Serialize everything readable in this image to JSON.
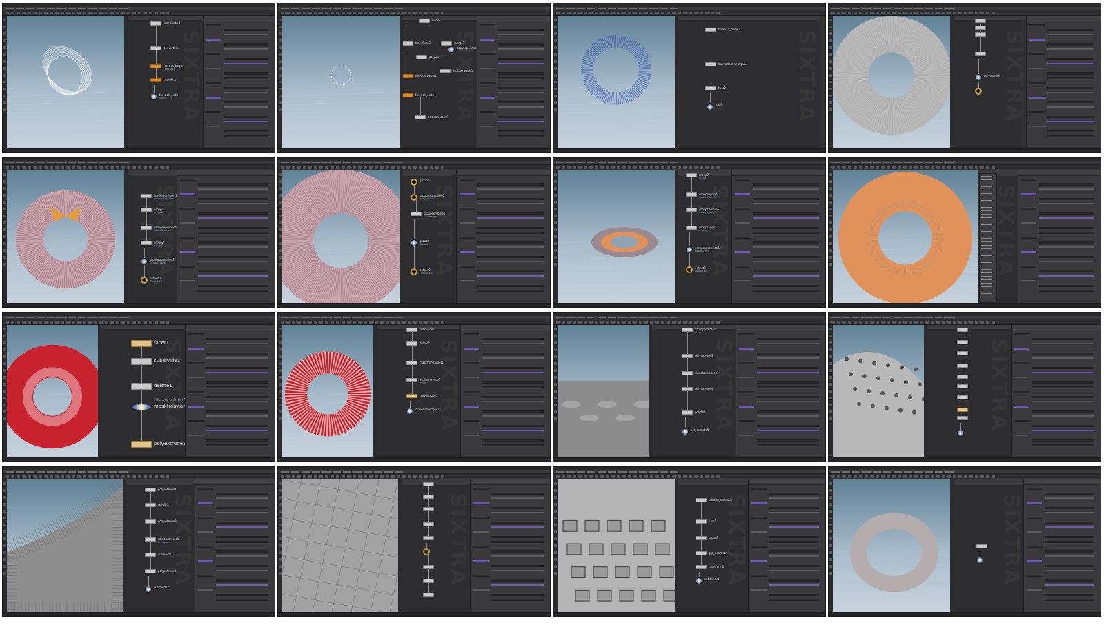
{
  "grid": {
    "columns": 4,
    "rows": 4
  },
  "shots": [
    {
      "id": "s1",
      "nodes": [
        {
          "label": "facetEmbed",
          "sub": ""
        },
        {
          "label": "convertLine",
          "sub": ""
        },
        {
          "label": "foreach_begin1",
          "sub": "FeedBack_1",
          "style": "orange"
        },
        {
          "label": "trans&ctrl",
          "sub": "",
          "style": "orange"
        },
        {
          "label": "foreach_end1",
          "sub": "Merge - 16",
          "style": "disp"
        }
      ]
    },
    {
      "id": "s2",
      "nodes": [
        {
          "label": "circle1",
          "sub": ""
        },
        {
          "label": "transform3",
          "sub": ""
        },
        {
          "label": "polywire1",
          "sub": ""
        },
        {
          "label": "merge1",
          "sub": ""
        },
        {
          "label": "copytopoints1",
          "sub": "",
          "style": "disp"
        },
        {
          "label": "foreach_begin1",
          "sub": "",
          "style": "orange"
        },
        {
          "label": "attribwrangle1",
          "sub": ""
        },
        {
          "label": "foreach_end1",
          "sub": "",
          "style": "orange"
        },
        {
          "label": "boolean_color1",
          "sub": ""
        }
      ]
    },
    {
      "id": "s3",
      "nodes": [
        {
          "label": "boolean_curve2",
          "sub": ""
        },
        {
          "label": "intersectionanalysis",
          "sub": ""
        },
        {
          "label": "fuse2",
          "sub": ""
        },
        {
          "label": "add1",
          "sub": "",
          "style": "disp"
        }
      ]
    },
    {
      "id": "s4",
      "nodes": [
        {
          "label": "",
          "sub": ""
        },
        {
          "label": "",
          "sub": ""
        },
        {
          "label": "",
          "sub": ""
        },
        {
          "label": "",
          "sub": ""
        },
        {
          "label": "polyextrude",
          "sub": "",
          "style": "disp"
        },
        {
          "label": "",
          "sub": "",
          "style": "ring"
        }
      ]
    },
    {
      "id": "s5",
      "nodes": [
        {
          "label": "lab-feature-sort1",
          "sub": "groupexpression1"
        },
        {
          "label": "group1",
          "sub": "group1"
        },
        {
          "label": "groupexpression2",
          "sub": "flower1_base"
        },
        {
          "label": "group2",
          "sub": "group2"
        },
        {
          "label": "groupexpression3",
          "sub": "flower1_base",
          "style": "disp"
        },
        {
          "label": "output0",
          "sub": "Output #0",
          "style": "ring"
        }
      ]
    },
    {
      "id": "s6",
      "nodes": [
        {
          "label": "group4",
          "sub": "",
          "style": "ring"
        },
        {
          "label": "groupexpression6",
          "sub": "inst_flower1",
          "style": "ring"
        },
        {
          "label": "groupcombine1",
          "sub": "flowers_grp"
        },
        {
          "label": "group3",
          "sub": "group3",
          "style": "disp"
        },
        {
          "label": "output0",
          "sub": "Output #0",
          "style": "ring"
        }
      ]
    },
    {
      "id": "s7",
      "nodes": [
        {
          "label": "group7",
          "sub": "group7"
        },
        {
          "label": "groupexpand1",
          "sub": "flower1_base7"
        },
        {
          "label": "groupcombine2",
          "sub": "flowers_grp"
        },
        {
          "label": "grouprange1",
          "sub": "ring_grp_1"
        },
        {
          "label": "groupexpression5",
          "sub": "flower1_grp",
          "style": "disp"
        },
        {
          "label": "output0",
          "sub": "Output #0",
          "style": "ring"
        }
      ]
    },
    {
      "id": "s8",
      "nodes": [
        {
          "label": "",
          "sub": ""
        },
        {
          "label": "",
          "sub": ""
        },
        {
          "label": "",
          "sub": "",
          "style": "disp"
        }
      ]
    },
    {
      "id": "s9",
      "nodes": [
        {
          "label": "facet1",
          "sub": "",
          "style": "tan"
        },
        {
          "label": "subdivide1",
          "sub": ""
        },
        {
          "label": "delete1",
          "sub": ""
        },
        {
          "label": "maskfromtarget1",
          "sub": "Distance from Targe",
          "style": "disp"
        },
        {
          "label": "polyextrude3",
          "sub": "",
          "style": "tan"
        }
      ]
    },
    {
      "id": "s10",
      "nodes": [
        {
          "label": "subdivide1",
          "sub": ""
        },
        {
          "label": "delete1",
          "sub": ""
        },
        {
          "label": "maskfromtarget1",
          "sub": ""
        },
        {
          "label": "attribpromote1",
          "sub": "mask"
        },
        {
          "label": "polyextrude3",
          "sub": "",
          "style": "tan"
        },
        {
          "label": "circlefromedges1",
          "sub": "",
          "style": "disp"
        }
      ]
    },
    {
      "id": "s11",
      "nodes": [
        {
          "label": "attribpromote1",
          "sub": "mask"
        },
        {
          "label": "polyextrude3",
          "sub": ""
        },
        {
          "label": "circlefromedges1",
          "sub": ""
        },
        {
          "label": "polyextrude4",
          "sub": ""
        },
        {
          "label": "polyfill1",
          "sub": ""
        },
        {
          "label": "polyextrude5",
          "sub": "",
          "style": "disp"
        }
      ]
    },
    {
      "id": "s12",
      "nodes": [
        {
          "label": "",
          "sub": ""
        },
        {
          "label": "",
          "sub": ""
        },
        {
          "label": "",
          "sub": ""
        },
        {
          "label": "",
          "sub": ""
        },
        {
          "label": "",
          "sub": ""
        },
        {
          "label": "",
          "sub": ""
        },
        {
          "label": "",
          "sub": ""
        },
        {
          "label": "",
          "sub": "",
          "style": "tan"
        },
        {
          "label": "",
          "sub": ""
        },
        {
          "label": "",
          "sub": "",
          "style": "disp"
        }
      ]
    },
    {
      "id": "s13",
      "nodes": [
        {
          "label": "polyextrude4",
          "sub": ""
        },
        {
          "label": "polyfill1",
          "sub": ""
        },
        {
          "label": "polyextrude3",
          "sub": ""
        },
        {
          "label": "attribpromote1",
          "sub": "area_point"
        },
        {
          "label": "subdivide1",
          "sub": ""
        },
        {
          "label": "polyextrude1",
          "sub": ""
        },
        {
          "label": "subdivide2",
          "sub": "",
          "style": "disp"
        }
      ]
    },
    {
      "id": "s14",
      "nodes": [
        {
          "label": "",
          "sub": ""
        },
        {
          "label": "",
          "sub": ""
        },
        {
          "label": "",
          "sub": ""
        },
        {
          "label": "",
          "sub": ""
        },
        {
          "label": "",
          "sub": ""
        },
        {
          "label": "",
          "sub": "",
          "style": "ring"
        },
        {
          "label": "",
          "sub": ""
        },
        {
          "label": "",
          "sub": ""
        },
        {
          "label": "",
          "sub": ""
        }
      ]
    },
    {
      "id": "s15",
      "nodes": [
        {
          "label": "pattern_variation",
          "sub": ""
        },
        {
          "label": "fuse1",
          "sub": ""
        },
        {
          "label": "group1",
          "sub": ""
        },
        {
          "label": "grp_geometry1",
          "sub": ""
        },
        {
          "label": "transform1",
          "sub": ""
        },
        {
          "label": "subdivide1",
          "sub": "",
          "style": "disp"
        }
      ]
    },
    {
      "id": "s16",
      "nodes": [
        {
          "label": "",
          "sub": ""
        },
        {
          "label": "",
          "sub": "",
          "style": "disp"
        }
      ]
    }
  ],
  "watermark_text": "SIXTRA",
  "colors": {
    "viewport_top": "#5f8196",
    "viewport_bottom": "#c7d3dd",
    "node_orange": "#d78a2e",
    "mesh_pink": "#c9a3ac",
    "mesh_orange": "#e0925a",
    "mesh_red": "#c8222e",
    "mesh_grey": "#b8b8b8"
  },
  "icons": [
    "node-display-flag-icon",
    "node-output-icon"
  ]
}
